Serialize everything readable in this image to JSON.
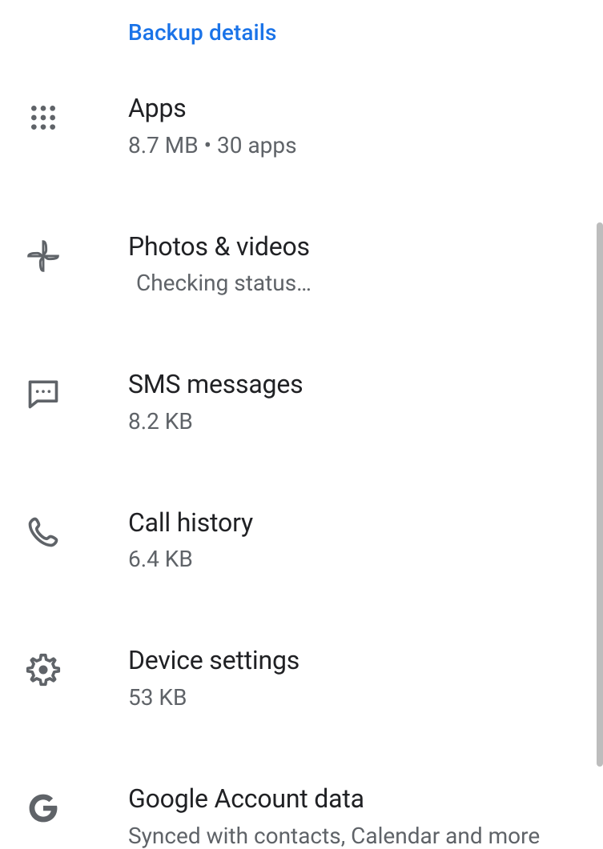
{
  "section_header": "Backup details",
  "items": [
    {
      "id": "apps",
      "title": "Apps",
      "subtitle": "8.7 MB • 30 apps"
    },
    {
      "id": "photos",
      "title": "Photos & videos",
      "subtitle": "Checking status…"
    },
    {
      "id": "sms",
      "title": "SMS messages",
      "subtitle": "8.2 KB"
    },
    {
      "id": "call",
      "title": "Call history",
      "subtitle": "6.4 KB"
    },
    {
      "id": "device",
      "title": "Device settings",
      "subtitle": "53 KB"
    },
    {
      "id": "google",
      "title": "Google Account data",
      "subtitle": "Synced with contacts, Calendar and more"
    }
  ]
}
